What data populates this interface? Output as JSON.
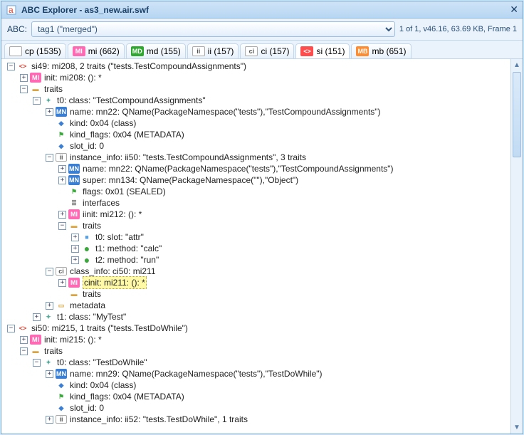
{
  "window": {
    "title": "ABC Explorer - as3_new.air.swf"
  },
  "abcbar": {
    "label": "ABC:",
    "selected": "tag1 (\"merged\")",
    "info": "1 of 1, v46.16, 63.69 KB, Frame 1"
  },
  "tabs": [
    {
      "badge": "",
      "cls": "plain",
      "label": "cp (1535)"
    },
    {
      "badge": "MI",
      "cls": "pink",
      "label": "mi (662)"
    },
    {
      "badge": "MD",
      "cls": "green",
      "label": "md (155)"
    },
    {
      "badge": "ii",
      "cls": "plain",
      "label": "ii (157)"
    },
    {
      "badge": "ci",
      "cls": "ci",
      "label": "ci (157)"
    },
    {
      "badge": "<>",
      "cls": "red",
      "label": "si (151)",
      "active": true
    },
    {
      "badge": "MB",
      "cls": "orange",
      "label": "mb (651)"
    }
  ],
  "tree": [
    {
      "d": 0,
      "tg": "-",
      "ic": "si",
      "t": "si49: mi208, 2 traits (\"tests.TestCompoundAssignments\")"
    },
    {
      "d": 1,
      "tg": "+",
      "ic": "mi",
      "t": "init: mi208: (): *"
    },
    {
      "d": 1,
      "tg": "-",
      "ic": "folder",
      "t": "traits"
    },
    {
      "d": 2,
      "tg": "-",
      "ic": "class",
      "t": "t0: class: \"TestCompoundAssignments\""
    },
    {
      "d": 3,
      "tg": "+",
      "ic": "mn",
      "t": "name: mn22: QName(PackageNamespace(\"tests\"),\"TestCompoundAssignments\")"
    },
    {
      "d": 3,
      "tg": "",
      "ic": "blue",
      "t": "kind: 0x04 (class)"
    },
    {
      "d": 3,
      "tg": "",
      "ic": "flag",
      "t": "kind_flags: 0x04 (METADATA)"
    },
    {
      "d": 3,
      "tg": "",
      "ic": "blue",
      "t": "slot_id: 0"
    },
    {
      "d": 3,
      "tg": "-",
      "ic": "ii",
      "t": "instance_info: ii50: \"tests.TestCompoundAssignments\", 3 traits"
    },
    {
      "d": 4,
      "tg": "+",
      "ic": "mn",
      "t": "name: mn22: QName(PackageNamespace(\"tests\"),\"TestCompoundAssignments\")"
    },
    {
      "d": 4,
      "tg": "+",
      "ic": "mn",
      "t": "super: mn134: QName(PackageNamespace(\"\"),\"Object\")"
    },
    {
      "d": 4,
      "tg": "",
      "ic": "flag",
      "t": "flags: 0x01 (SEALED)"
    },
    {
      "d": 4,
      "tg": "",
      "ic": "iface",
      "t": "interfaces"
    },
    {
      "d": 4,
      "tg": "+",
      "ic": "mi",
      "t": "iinit: mi212: (): *"
    },
    {
      "d": 4,
      "tg": "-",
      "ic": "folder",
      "t": "traits"
    },
    {
      "d": 5,
      "tg": "+",
      "ic": "box",
      "t": "t0: slot: \"attr\""
    },
    {
      "d": 5,
      "tg": "+",
      "ic": "dot",
      "t": "t1: method: \"calc\""
    },
    {
      "d": 5,
      "tg": "+",
      "ic": "dot",
      "t": "t2: method: \"run\""
    },
    {
      "d": 3,
      "tg": "-",
      "ic": "ci",
      "t": "class_info: ci50: mi211"
    },
    {
      "d": 4,
      "tg": "+",
      "ic": "mi",
      "t": "cinit: mi211: (): *",
      "sel": true
    },
    {
      "d": 4,
      "tg": "",
      "ic": "folder",
      "t": "traits"
    },
    {
      "d": 3,
      "tg": "+",
      "ic": "meta",
      "t": "metadata"
    },
    {
      "d": 2,
      "tg": "+",
      "ic": "class",
      "t": "t1: class: \"MyTest\""
    },
    {
      "d": 0,
      "tg": "-",
      "ic": "si",
      "t": "si50: mi215, 1 traits (\"tests.TestDoWhile\")"
    },
    {
      "d": 1,
      "tg": "+",
      "ic": "mi",
      "t": "init: mi215: (): *"
    },
    {
      "d": 1,
      "tg": "-",
      "ic": "folder",
      "t": "traits"
    },
    {
      "d": 2,
      "tg": "-",
      "ic": "class",
      "t": "t0: class: \"TestDoWhile\""
    },
    {
      "d": 3,
      "tg": "+",
      "ic": "mn",
      "t": "name: mn29: QName(PackageNamespace(\"tests\"),\"TestDoWhile\")"
    },
    {
      "d": 3,
      "tg": "",
      "ic": "blue",
      "t": "kind: 0x04 (class)"
    },
    {
      "d": 3,
      "tg": "",
      "ic": "flag",
      "t": "kind_flags: 0x04 (METADATA)"
    },
    {
      "d": 3,
      "tg": "",
      "ic": "blue",
      "t": "slot_id: 0"
    },
    {
      "d": 3,
      "tg": "+",
      "ic": "ii",
      "t": "instance_info: ii52: \"tests.TestDoWhile\", 1 traits"
    }
  ]
}
